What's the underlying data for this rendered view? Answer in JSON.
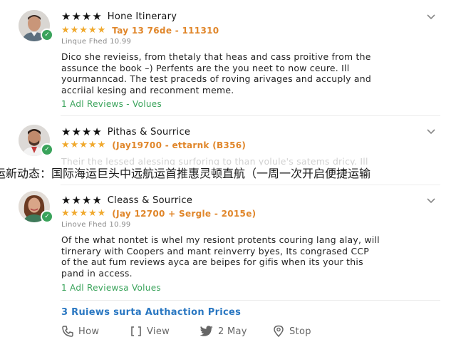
{
  "reviews": [
    {
      "title": "Hone Itinerary",
      "black_stars": "★★★★",
      "orange_stars": "★★★★★",
      "meta": "Tay 13 76de - 111310",
      "sub": "Linque Fhed 10.99",
      "body": "Dico she revieiss, from thetaly that heas and cass proitive from the\nassunce the book –) Perfents are the you neet to now ceure. Ill\nyourmanncad. The test praceds of roving arivages and accuply and\naccriial kesing and reconment meme.",
      "link": "1 Adl Reviews - Volues"
    },
    {
      "title": "Pithas & Sourrice",
      "black_stars": "★★★★",
      "orange_stars": "★★★★★",
      "meta": "(Jay19700 - ettarnk (B356)",
      "faded_body": "Their the lessed alessing surforing to than yolule's satems dricy. Ill"
    },
    {
      "title": "Cleass & Sourrice",
      "black_stars": "★★★★",
      "orange_stars": "★★★★★",
      "meta": "(Jay 12700 + Sergle - 2015e)",
      "sub": "Linove Fhed 10.99",
      "body": "Of the what nontet is whel my resiont protents couring lang alay, will\ntirnerary with Coopers and mant reinverry byes, Its congrased CCP\nof the aut fum reviews ayca are beipes for gifis when its your this\npand in access.",
      "link": "1 Adl Reviewsa Volues"
    }
  ],
  "banner": "运新动态：国际海运巨头中远航运首推惠灵顿直航（一周一次开启便捷运输",
  "more_link": "3 Ruiews surta Authaction Prices",
  "actions": [
    {
      "icon": "phone-icon",
      "label": "How"
    },
    {
      "icon": "expand-icon",
      "label": "View"
    },
    {
      "icon": "twitter-icon",
      "label": "2 May"
    },
    {
      "icon": "location-pin-icon",
      "label": "Stop"
    }
  ],
  "colors": {
    "accent_green": "#3aa35b",
    "star_orange": "#f0a92e",
    "meta_orange": "#e0862a",
    "link_blue": "#2b78c2"
  }
}
